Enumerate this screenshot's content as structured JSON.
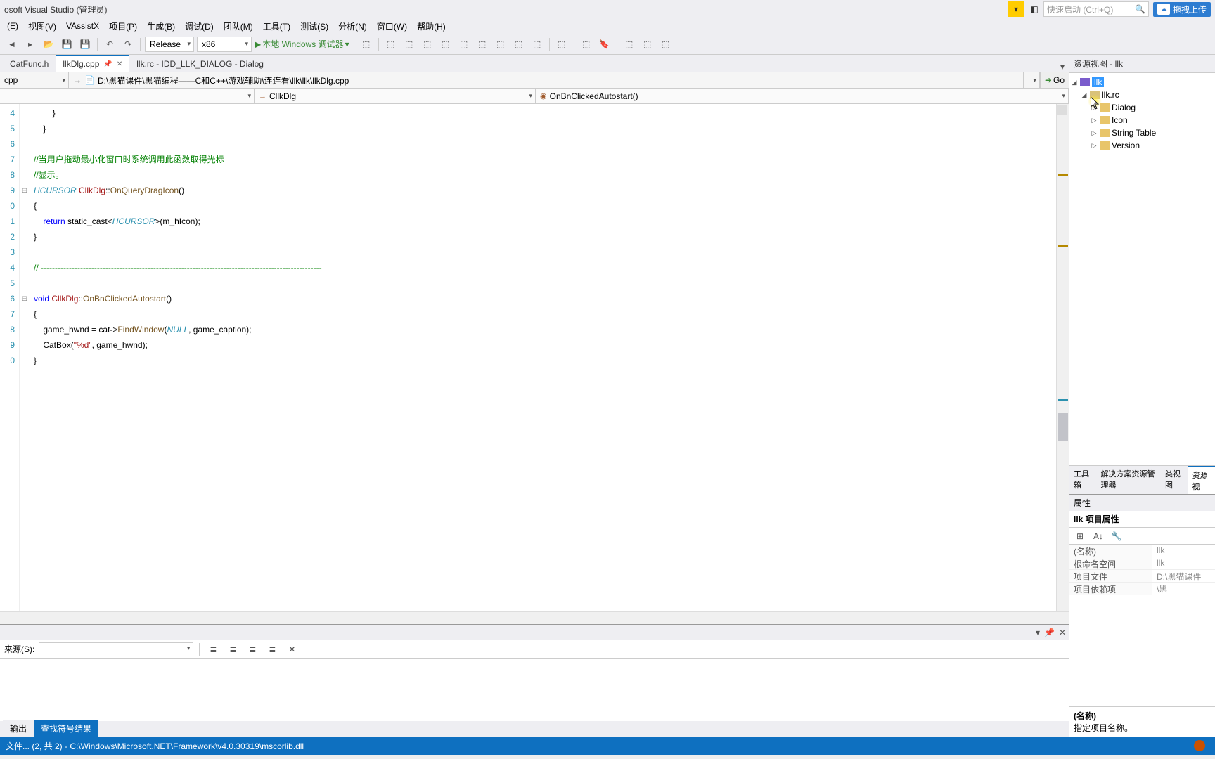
{
  "title": "osoft Visual Studio  (管理员)",
  "quick_launch_placeholder": "快速启动 (Ctrl+Q)",
  "cloud_button": "拖拽上传",
  "menu": [
    "(E)",
    "视图(V)",
    "VAssistX",
    "项目(P)",
    "生成(B)",
    "调试(D)",
    "团队(M)",
    "工具(T)",
    "测试(S)",
    "分析(N)",
    "窗口(W)",
    "帮助(H)"
  ],
  "toolbar": {
    "config": "Release",
    "platform": "x86",
    "debug_target": "本地 Windows 调试器"
  },
  "tabs": [
    {
      "label": "CatFunc.h",
      "active": false
    },
    {
      "label": "llkDlg.cpp",
      "active": true
    },
    {
      "label": "llk.rc - IDD_LLK_DIALOG - Dialog",
      "active": false
    }
  ],
  "nav": {
    "left_combo": "cpp",
    "path": "D:\\黑猫课件\\黑猫编程——C和C++\\游戏辅助\\连连看\\llk\\llk\\llkDlg.cpp",
    "go": "Go"
  },
  "scope": {
    "class": "CllkDlg",
    "method": "OnBnClickedAutostart()"
  },
  "line_numbers": [
    "4",
    "5",
    "6",
    "7",
    "8",
    "9",
    "0",
    "1",
    "2",
    "3",
    "4",
    "5",
    "6",
    "7",
    "8",
    "9",
    "0"
  ],
  "code": {
    "l1": "        }",
    "l2": "    }",
    "l3": "",
    "c1": "//当用户拖动最小化窗口时系统调用此函数取得光标",
    "c2": "//显示。",
    "sig1_type": "HCURSOR ",
    "sig1_cls": "CllkDlg",
    "sig1_sep": "::",
    "sig1_m": "OnQueryDragIcon",
    "sig1_end": "()",
    "open_brace": "{",
    "ret_kw": "    return ",
    "ret_cast": "static_cast",
    "ret_lt": "<",
    "ret_type": "HCURSOR",
    "ret_gt": ">(m_hIcon);",
    "close_brace": "}",
    "dash": "// ----------------------------------------------------------------------------------------------------",
    "sig2_void": "void ",
    "sig2_cls": "CllkDlg",
    "sig2_sep": "::",
    "sig2_m": "OnBnClickedAutostart",
    "sig2_end": "()",
    "b1a": "    game_hwnd = cat->",
    "b1m": "FindWindow",
    "b1p_open": "(",
    "b1_null": "NULL",
    "b1p_rest": ", game_caption);",
    "b2a": "    CatBox(",
    "b2s": "\"%d\"",
    "b2b": ", game_hwnd);"
  },
  "output": {
    "label": "来源(S):",
    "tabs": [
      "输出",
      "查找符号结果"
    ]
  },
  "resource_view": {
    "title": "资源视图 - llk",
    "root": "llk",
    "rc": "llk.rc",
    "items": [
      "Dialog",
      "Icon",
      "String Table",
      "Version"
    ]
  },
  "right_tabs": [
    "工具箱",
    "解决方案资源管理器",
    "类视图",
    "资源视"
  ],
  "properties": {
    "title": "属性",
    "subtitle": "llk 项目属性",
    "rows": [
      {
        "k": "(名称)",
        "v": "llk"
      },
      {
        "k": "根命名空间",
        "v": "llk"
      },
      {
        "k": "项目文件",
        "v": "D:\\黑猫课件\\黑"
      },
      {
        "k": "项目依赖项",
        "v": ""
      }
    ],
    "desc_k": "(名称)",
    "desc_v": "指定项目名称。"
  },
  "status": "文件...   (2, 共 2) - C:\\Windows\\Microsoft.NET\\Framework\\v4.0.30319\\mscorlib.dll"
}
